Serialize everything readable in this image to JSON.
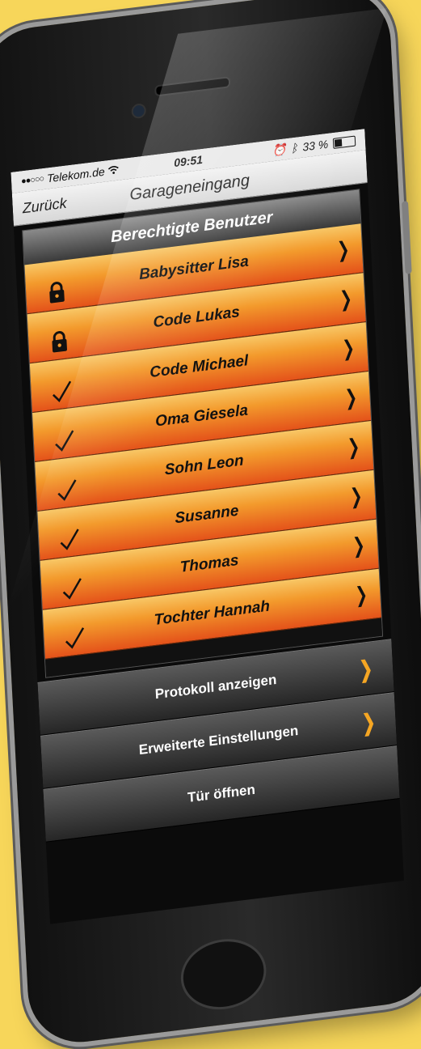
{
  "status_bar": {
    "carrier": "Telekom.de",
    "signal": "●●○○○",
    "wifi_icon": "wifi-icon",
    "time": "09:51",
    "battery_percent": "33 %",
    "battery_level": 0.33
  },
  "nav": {
    "back_label": "Zurück",
    "title": "Garageneingang"
  },
  "section": {
    "header": "Berechtigte Benutzer"
  },
  "users": [
    {
      "name": "Babysitter Lisa",
      "status_icon": "lock-icon"
    },
    {
      "name": "Code Lukas",
      "status_icon": "lock-icon"
    },
    {
      "name": "Code Michael",
      "status_icon": "checkmark-icon"
    },
    {
      "name": "Oma Giesela",
      "status_icon": "checkmark-icon"
    },
    {
      "name": "Sohn Leon",
      "status_icon": "checkmark-icon"
    },
    {
      "name": "Susanne",
      "status_icon": "checkmark-icon"
    },
    {
      "name": "Thomas",
      "status_icon": "checkmark-icon"
    },
    {
      "name": "Tochter Hannah",
      "status_icon": "checkmark-icon"
    }
  ],
  "actions": [
    {
      "label": "Protokoll anzeigen",
      "has_chevron": true
    },
    {
      "label": "Erweiterte Einstellungen",
      "has_chevron": true
    },
    {
      "label": "Tür öffnen",
      "has_chevron": false
    }
  ],
  "colors": {
    "background": "#f7d65a",
    "accent": "#f5a623",
    "row_top": "#f8c766",
    "row_bottom": "#e4521a"
  }
}
